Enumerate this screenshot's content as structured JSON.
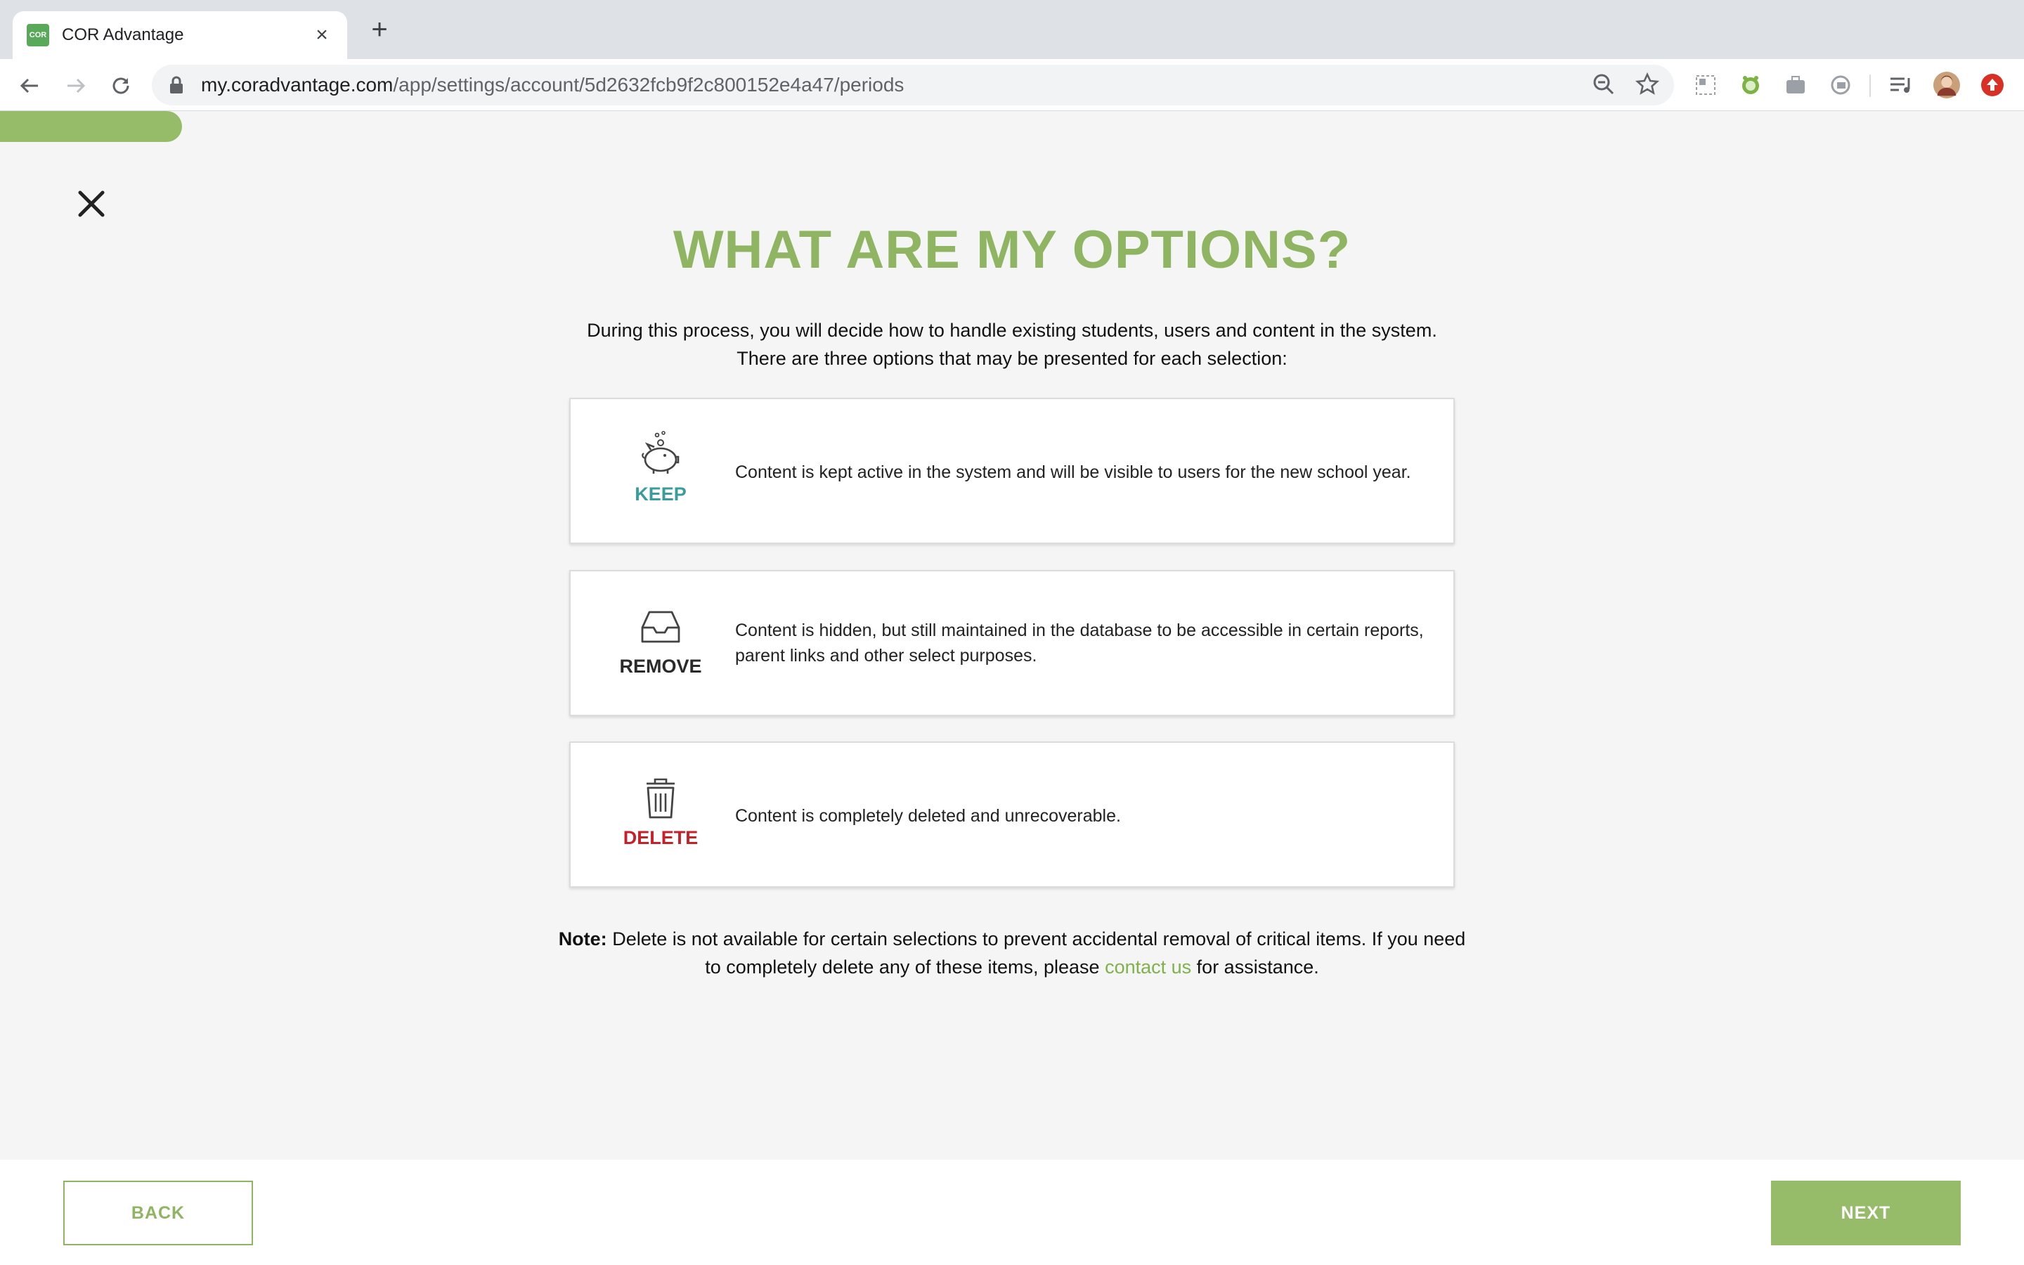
{
  "browser": {
    "tab_title": "COR Advantage",
    "favicon_text": "COR",
    "url_host": "my.coradvantage.com",
    "url_path": "/app/settings/account/5d2632fcb9f2c800152e4a47/periods"
  },
  "progress": {
    "fraction": 0.09
  },
  "page": {
    "title": "WHAT ARE MY OPTIONS?",
    "intro_line1": "During this process, you will decide how to handle existing students, users and content in the system.",
    "intro_line2": "There are three options that may be presented for each selection:"
  },
  "options": [
    {
      "label": "KEEP",
      "icon": "piggy-bank-icon",
      "color": "#3a9d9b",
      "description": "Content is kept active in the system and will be visible to users for the new school year."
    },
    {
      "label": "REMOVE",
      "icon": "inbox-tray-icon",
      "color": "#2a2a2a",
      "description": "Content is hidden, but still maintained in the database to be accessible in certain reports, parent links and other select purposes."
    },
    {
      "label": "DELETE",
      "icon": "trash-can-icon",
      "color": "#c8202a",
      "description": "Content is completely deleted and unrecoverable."
    }
  ],
  "note": {
    "bold": "Note:",
    "text_before": "Delete is not available for certain selections to prevent accidental removal of critical items. If you need to completely delete any of these items, please",
    "link": "contact us",
    "text_after": "for assistance."
  },
  "footer": {
    "back_label": "BACK",
    "next_label": "NEXT"
  },
  "colors": {
    "brand_green": "#96bc69",
    "title_green": "#8fb563"
  }
}
